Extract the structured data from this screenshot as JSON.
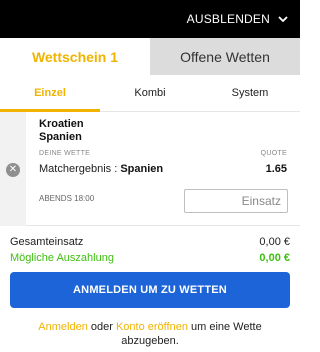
{
  "header": {
    "hide_label": "AUSBLENDEN"
  },
  "slip_tabs": [
    {
      "label": "Wettschein 1",
      "active": true
    },
    {
      "label": "Offene Wetten",
      "active": false
    }
  ],
  "mode_tabs": [
    {
      "label": "Einzel",
      "active": true
    },
    {
      "label": "Kombi",
      "active": false
    },
    {
      "label": "System",
      "active": false
    }
  ],
  "bet": {
    "team1": "Kroatien",
    "team2": "Spanien",
    "bet_label": "DEINE WETTE",
    "odds_label": "QUOTE",
    "market": "Matchergebnis : ",
    "selection": "Spanien",
    "odds": "1.65",
    "time": "ABENDS 18:00",
    "stake_placeholder": "Einsatz"
  },
  "totals": {
    "stake_label": "Gesamteinsatz",
    "stake_value": "0,00 €",
    "payout_label": "Mögliche Auszahlung",
    "payout_value": "0,00 €"
  },
  "cta_label": "ANMELDEN UM ZU WETTEN",
  "footer": {
    "login_link": "Anmelden",
    "or_text": " oder ",
    "register_link": "Konto eröffnen",
    "suffix": " um eine Wette abzugeben."
  },
  "colors": {
    "accent": "#f0b400",
    "cta": "#1d64d8",
    "payout": "#3fbf12",
    "topbar": "#000000"
  }
}
